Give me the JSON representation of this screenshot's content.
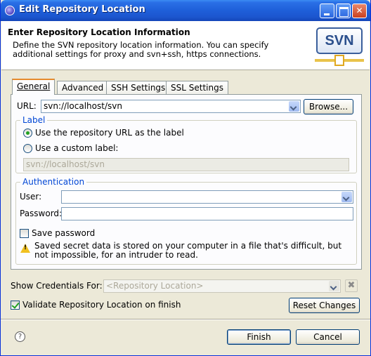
{
  "window": {
    "title": "Edit Repository Location"
  },
  "header": {
    "title": "Enter Repository Location Information",
    "description": "Define the SVN repository location information. You can specify additional settings for proxy and svn+ssh, https connections.",
    "logo_text": "SVN"
  },
  "tabs": [
    {
      "label": "General",
      "active": true
    },
    {
      "label": "Advanced",
      "active": false
    },
    {
      "label": "SSH Settings",
      "active": false
    },
    {
      "label": "SSL Settings",
      "active": false
    }
  ],
  "general": {
    "url_label": "URL:",
    "url_value": "svn://localhost/svn",
    "browse_label": "Browse...",
    "label_group": {
      "title": "Label",
      "radio_repo_url": "Use the repository URL as the label",
      "radio_custom": "Use a custom label:",
      "custom_value": "svn://localhost/svn",
      "selected": "repository_url"
    },
    "auth_group": {
      "title": "Authentication",
      "user_label": "User:",
      "user_value": "",
      "password_label": "Password:",
      "password_value": "",
      "save_password_label": "Save password",
      "save_password_checked": false,
      "warning": "Saved secret data is stored on your computer in a file that's difficult, but not impossible, for an intruder to read."
    }
  },
  "credentials": {
    "label": "Show Credentials For:",
    "value": "<Repository Location>"
  },
  "validate": {
    "label": "Validate Repository Location on finish",
    "checked": true
  },
  "buttons": {
    "reset": "Reset Changes",
    "finish": "Finish",
    "cancel": "Cancel",
    "help": "?"
  },
  "colors": {
    "titlebar": "#1e5fd9",
    "group_title": "#0046d5",
    "active_tab_accent": "#e68b2c"
  }
}
